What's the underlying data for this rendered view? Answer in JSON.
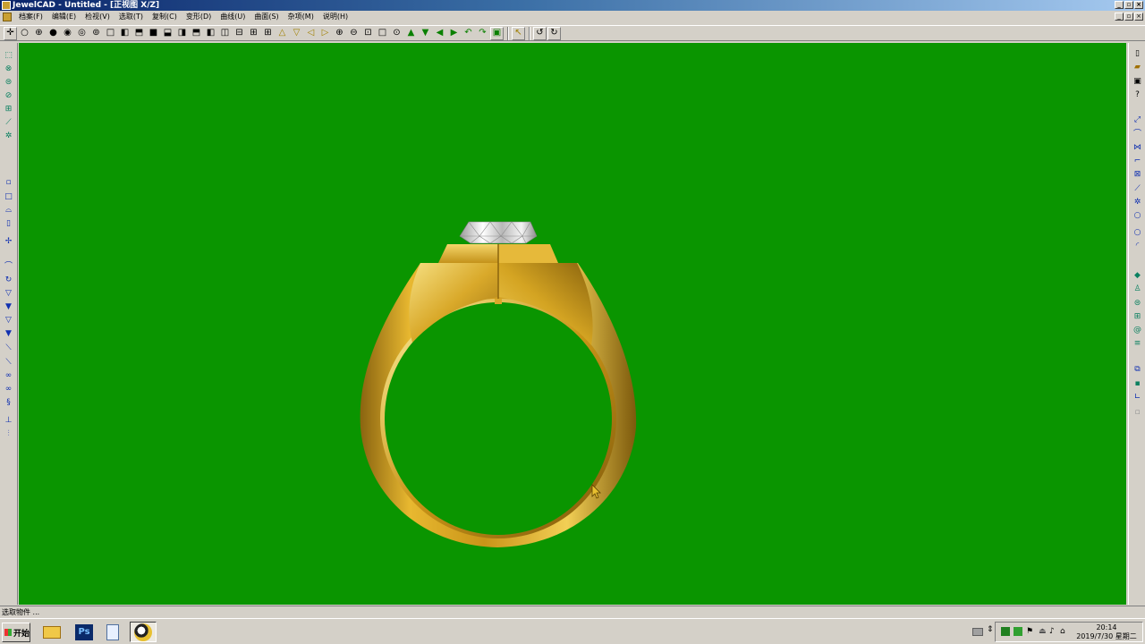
{
  "window": {
    "title": "JewelCAD - Untitled - [正视图 X/Z]"
  },
  "menu": {
    "items": [
      "档案(F)",
      "编辑(E)",
      "检视(V)",
      "选取(T)",
      "复制(C)",
      "变形(D)",
      "曲线(U)",
      "曲面(S)",
      "杂项(M)",
      "说明(H)"
    ]
  },
  "viewport": {
    "background_color": "#0a9500",
    "object": "gold ring with bezel-set diamond"
  },
  "status": {
    "text": "选取物件 ..."
  },
  "taskbar": {
    "start_label": "开始",
    "ps_label": "Ps",
    "clock_time": "20:14",
    "clock_date": "2019/7/30 星期二"
  },
  "colors": {
    "titlebar": "#0a246a",
    "viewport": "#0a9500",
    "gold": "#d4a520",
    "chrome": "#d4d0c8"
  }
}
